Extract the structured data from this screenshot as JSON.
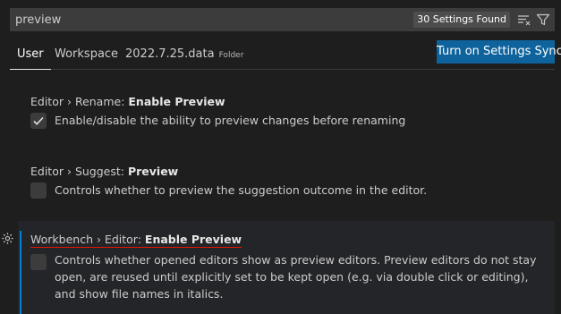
{
  "search": {
    "value": "preview",
    "count_label": "30 Settings Found",
    "icons": [
      "clear-filter-icon",
      "filter-icon"
    ]
  },
  "tabs": [
    {
      "label": "User"
    },
    {
      "label": "Workspace"
    },
    {
      "label": "2022.7.25.data",
      "tag": "Folder"
    }
  ],
  "sync_button": {
    "label": "Turn on Settings Sync"
  },
  "colors": {
    "background": "#1e1e1e",
    "accent": "#007fd4",
    "button": "#0e639c",
    "modified_underline": "#e51400"
  },
  "settings": [
    {
      "prefix": "Editor › Rename: ",
      "key": "Enable Preview",
      "checked": true,
      "description": "Enable/disable the ability to preview changes before renaming"
    },
    {
      "prefix": "Editor › Suggest: ",
      "key": "Preview",
      "checked": false,
      "description": "Controls whether to preview the suggestion outcome in the editor."
    },
    {
      "prefix": "Workbench › Editor: ",
      "key": "Enable Preview",
      "checked": false,
      "description": "Controls whether opened editors show as preview editors. Preview editors do not stay open, are reused until explicitly set to be kept open (e.g. via double click or editing), and show file names in italics."
    }
  ]
}
